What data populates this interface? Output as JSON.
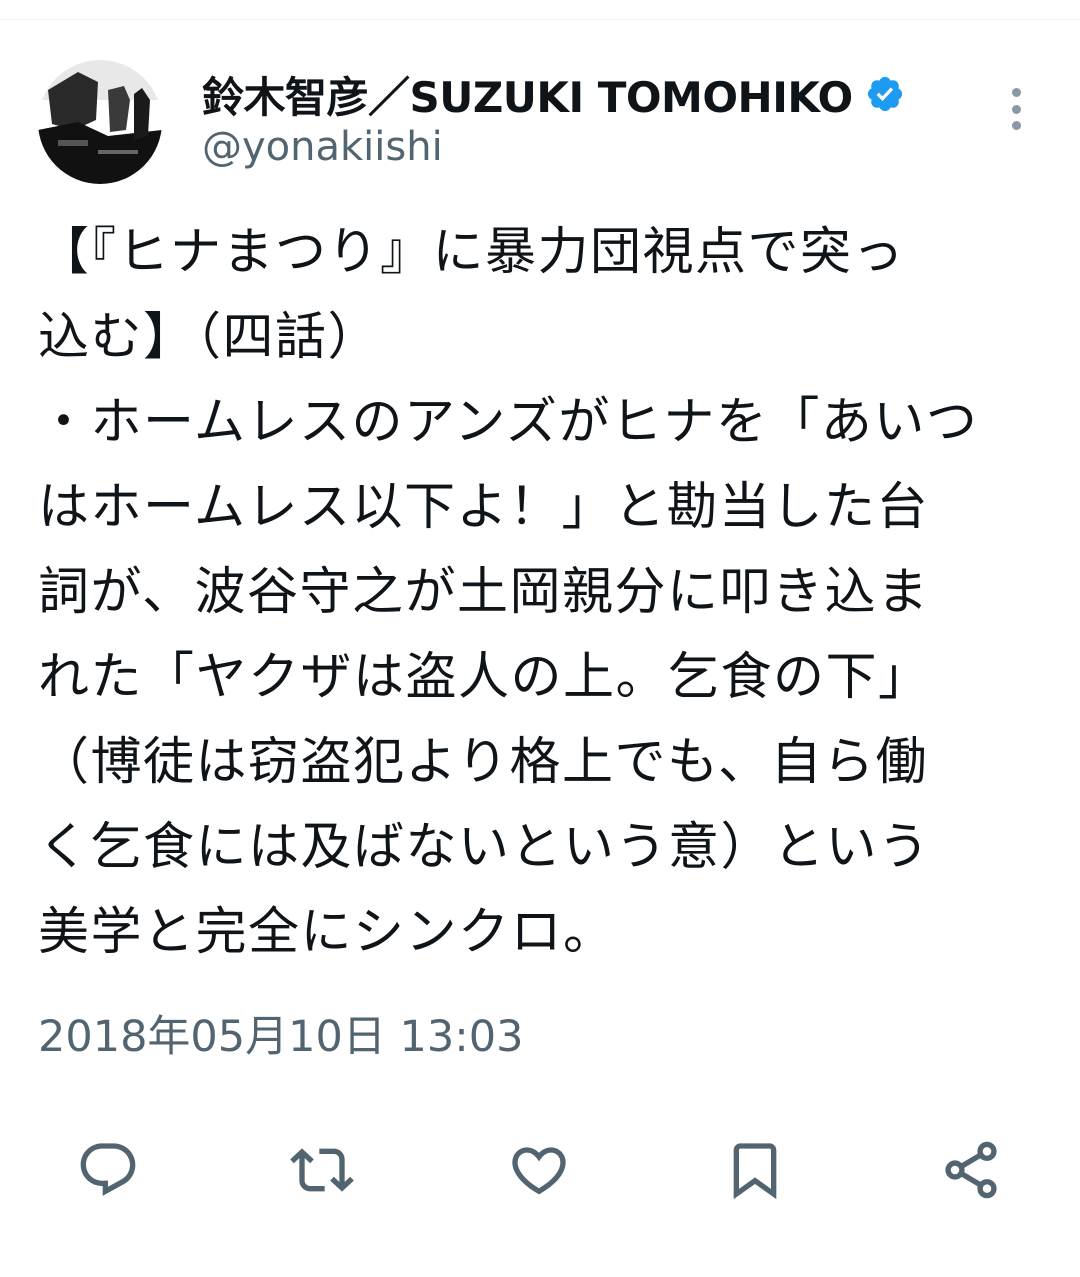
{
  "author": {
    "display_name": "鈴木智彦／SUZUKI TOMOHIKO",
    "handle": "@yonakiishi",
    "verified": true,
    "avatar": "profile-photo"
  },
  "tweet": {
    "text": "【『ヒナまつり』に暴力団視点で突っ\n込む】（四話）\n・ホームレスのアンズがヒナを「あいつ\nはホームレス以下よ！」と勘当した台\n詞が、波谷守之が土岡親分に叩き込ま\nれた「ヤクザは盗人の上。乞食の下」\n（博徒は窃盗犯より格上でも、自ら働\nく乞食には及ばないという意）という\n美学と完全にシンクロ。",
    "timestamp": "2018年05月10日 13:03"
  },
  "actions": [
    {
      "name": "reply",
      "icon": "comment-icon"
    },
    {
      "name": "retweet",
      "icon": "retweet-icon"
    },
    {
      "name": "like",
      "icon": "heart-icon"
    },
    {
      "name": "bookmark",
      "icon": "bookmark-icon"
    },
    {
      "name": "share",
      "icon": "share-icon"
    }
  ],
  "colors": {
    "text": "#0f1419",
    "secondary": "#536471",
    "verified": "#1d9bf0"
  }
}
